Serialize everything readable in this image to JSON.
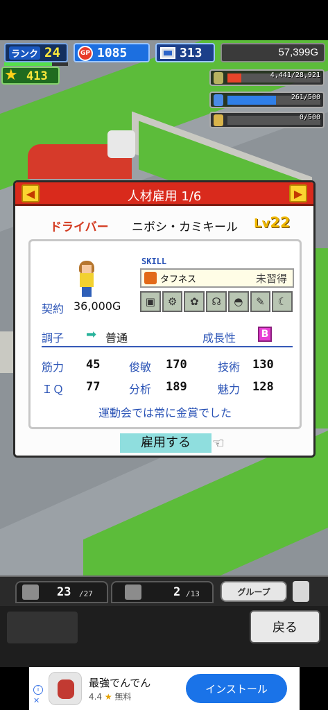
{
  "hud": {
    "rank_label": "ランク",
    "rank": "24",
    "rank_progress": 0.75,
    "gp": "1085",
    "gp_icon_label": "GP",
    "pc": "313",
    "money": "57,399G",
    "stars": "413",
    "resources": [
      {
        "icon": "fuel-icon",
        "value": "4,441/28,921",
        "fill": 0.15,
        "color": "#e8452a"
      },
      {
        "icon": "water-icon",
        "value": "261/500",
        "fill": 0.52,
        "color": "#2f7fe8"
      },
      {
        "icon": "wheat-icon",
        "value": "0/500",
        "fill": 0.0,
        "color": "#e8c52a"
      }
    ]
  },
  "dialog": {
    "title": "人材雇用 1/6",
    "job": "ドライバー",
    "name": "ニボシ・カミキール",
    "level_tag": "Lv",
    "level": "22",
    "contract_label": "契約",
    "contract_value": "36,000G",
    "skill_header": "SKILL",
    "skill_name": "タフネス",
    "skill_status": "未習得",
    "condition_label": "調子",
    "condition_value": "普通",
    "growth_label": "成長性",
    "growth_value": "B",
    "stats": [
      {
        "label": "筋力",
        "value": "45"
      },
      {
        "label": "俊敏",
        "value": "170"
      },
      {
        "label": "技術",
        "value": "130"
      },
      {
        "label": "ＩＱ",
        "value": "77"
      },
      {
        "label": "分析",
        "value": "189"
      },
      {
        "label": "魅力",
        "value": "128"
      }
    ],
    "comment": "運動会では常に金賞でした",
    "hire_button": "雇用する"
  },
  "tabs": {
    "staff_count": "23",
    "staff_max": "/27",
    "garage_count": "2",
    "garage_max": "/13",
    "group_label": "グループ"
  },
  "bottom": {
    "back_button": "戻る"
  },
  "ad": {
    "title": "最強でんでん",
    "rating": "4.4",
    "price": "無料",
    "install_button": "インストール"
  }
}
